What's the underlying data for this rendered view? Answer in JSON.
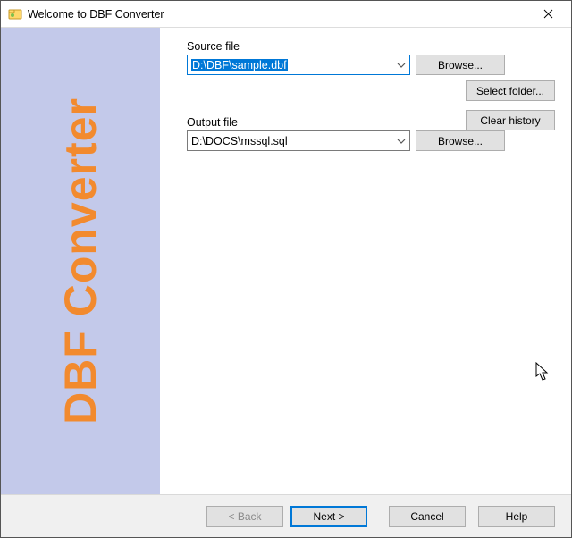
{
  "window": {
    "title": "Welcome to DBF Converter"
  },
  "sidebar": {
    "brand": "DBF Converter"
  },
  "source": {
    "label": "Source file",
    "value": "D:\\DBF\\sample.dbf",
    "browse": "Browse...",
    "select_folder": "Select folder...",
    "clear_history": "Clear history"
  },
  "output": {
    "label": "Output file",
    "value": "D:\\DOCS\\mssql.sql",
    "browse": "Browse..."
  },
  "footer": {
    "back": "< Back",
    "next": "Next >",
    "cancel": "Cancel",
    "help": "Help"
  }
}
